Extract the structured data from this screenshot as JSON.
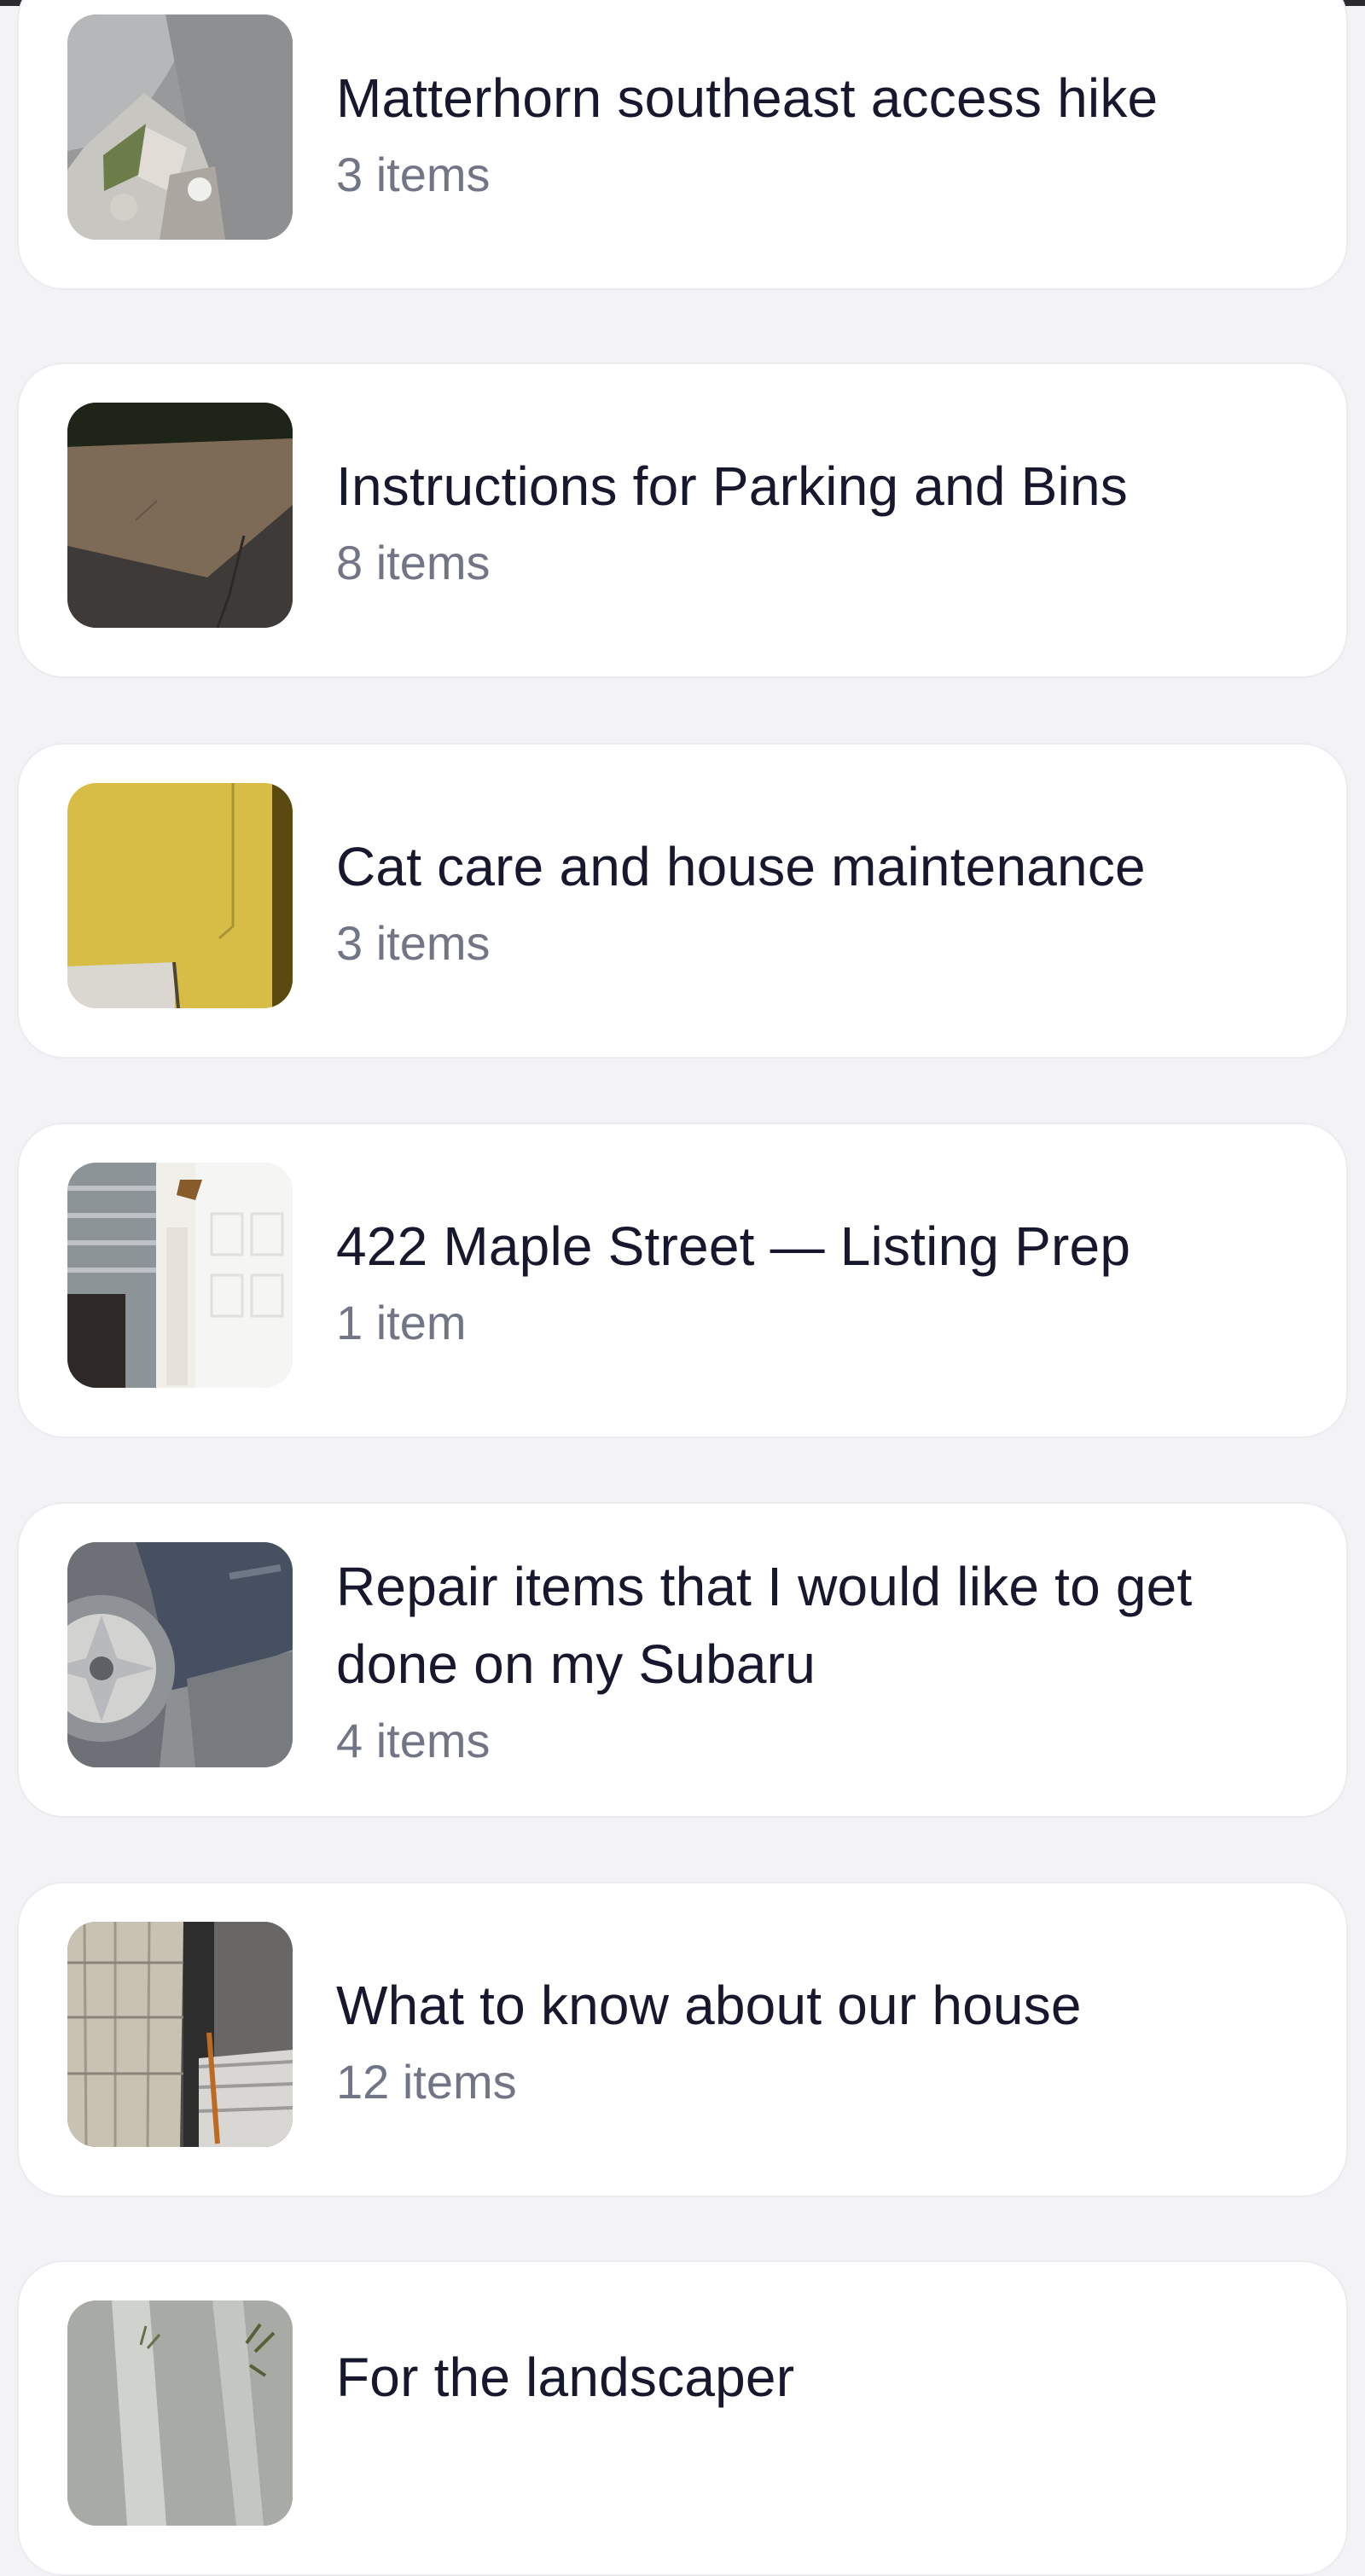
{
  "collections": [
    {
      "title": "Matterhorn southeast access hike",
      "count": "3 items",
      "thumbnail_icon": "mountain-rock-photo"
    },
    {
      "title": "Instructions for Parking and Bins",
      "count": "8 items",
      "thumbnail_icon": "concrete-ground-photo"
    },
    {
      "title": "Cat care and house maintenance",
      "count": "3 items",
      "thumbnail_icon": "yellow-wall-photo"
    },
    {
      "title": "422 Maple Street — Listing Prep",
      "count": "1 item",
      "thumbnail_icon": "garage-door-photo"
    },
    {
      "title": "Repair items that I would like to get done on my Subaru",
      "count": "4 items",
      "thumbnail_icon": "car-wheel-photo"
    },
    {
      "title": "What to know about our house",
      "count": "12 items",
      "thumbnail_icon": "house-interior-photo"
    },
    {
      "title": "For the landscaper",
      "count": "",
      "thumbnail_icon": "yard-path-photo"
    }
  ],
  "colors": {
    "background": "#f3f3f5",
    "card": "#ffffff",
    "title": "#17172d",
    "count": "#727585"
  }
}
